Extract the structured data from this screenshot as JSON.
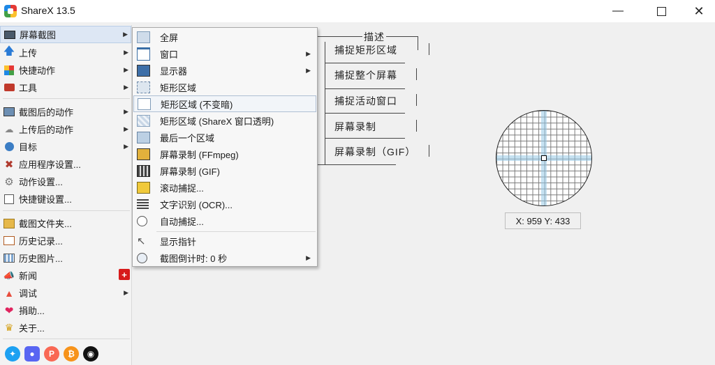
{
  "window": {
    "title": "ShareX 13.5"
  },
  "menu": {
    "items": [
      {
        "label": "屏幕截图"
      },
      {
        "label": "上传"
      },
      {
        "label": "快捷动作"
      },
      {
        "label": "工具"
      },
      {
        "label": "截图后的动作"
      },
      {
        "label": "上传后的动作"
      },
      {
        "label": "目标"
      },
      {
        "label": "应用程序设置..."
      },
      {
        "label": "动作设置..."
      },
      {
        "label": "快捷键设置..."
      },
      {
        "label": "截图文件夹..."
      },
      {
        "label": "历史记录..."
      },
      {
        "label": "历史图片..."
      },
      {
        "label": "新闻"
      },
      {
        "label": "调试"
      },
      {
        "label": "捐助..."
      },
      {
        "label": "关于..."
      }
    ],
    "news_badge": "+"
  },
  "submenu": {
    "items": [
      {
        "label": "全屏"
      },
      {
        "label": "窗口"
      },
      {
        "label": "显示器"
      },
      {
        "label": "矩形区域"
      },
      {
        "label": "矩形区域 (不变暗)"
      },
      {
        "label": "矩形区域 (ShareX 窗口透明)"
      },
      {
        "label": "最后一个区域"
      },
      {
        "label": "屏幕录制 (FFmpeg)"
      },
      {
        "label": "屏幕录制 (GIF)"
      },
      {
        "label": "滚动捕捉..."
      },
      {
        "label": "文字识别 (OCR)..."
      },
      {
        "label": "自动捕捉..."
      },
      {
        "label": "显示指针"
      },
      {
        "label": "截图倒计时: 0 秒"
      }
    ]
  },
  "diagram": {
    "title": "描述",
    "labels": [
      "捕捉矩形区域",
      "捕捉整个屏幕",
      "捕捉活动窗口",
      "屏幕录制",
      "屏幕录制（GIF）"
    ]
  },
  "magnifier": {
    "coords": "X: 959 Y: 433"
  },
  "colors": {
    "highlight": "#dde7f4",
    "badge": "#d71b1b",
    "twitter": "#1da1f2",
    "discord": "#5865f2",
    "patreon": "#f96854",
    "bitcoin": "#f7931a",
    "github": "#111111"
  }
}
